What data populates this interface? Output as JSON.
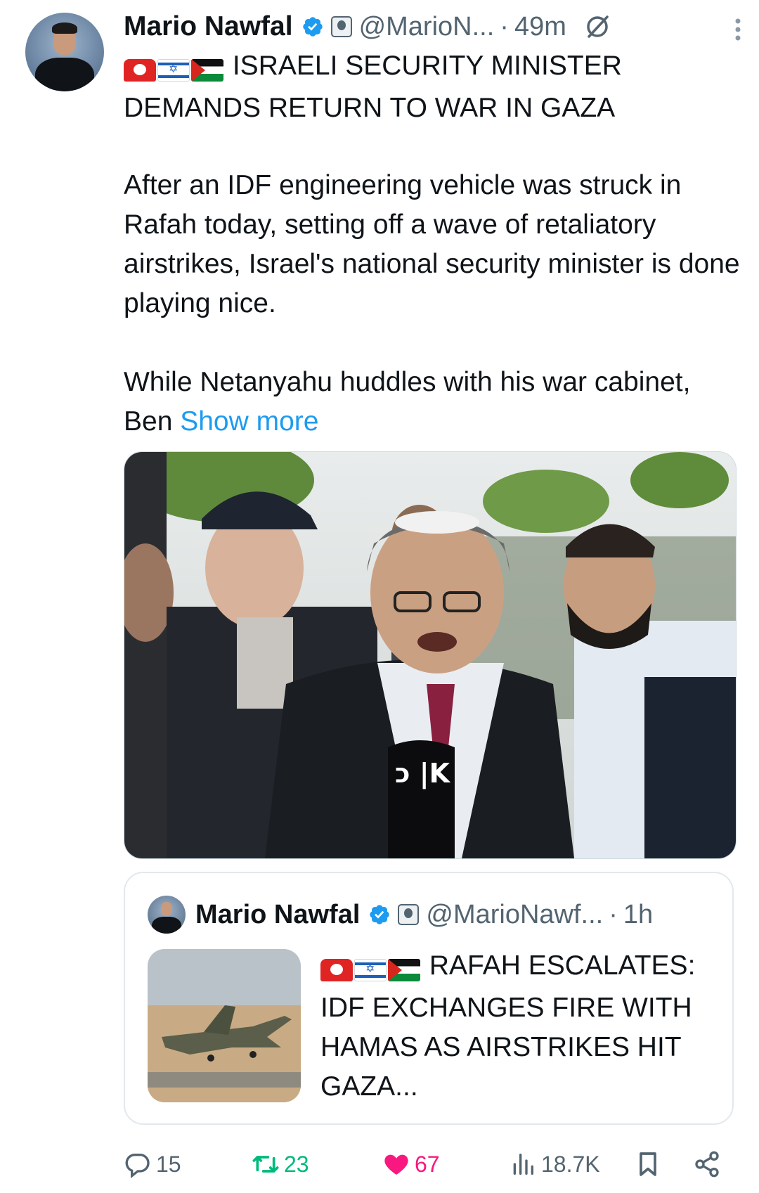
{
  "author": {
    "name": "Mario Nawfal",
    "handle": "@MarioN...",
    "separator": "·",
    "time": "49m"
  },
  "tweet": {
    "headline": "ISRAELI SECURITY MINISTER DEMANDS RETURN TO WAR IN GAZA",
    "paragraph1": "After an IDF engineering vehicle was struck in Rafah today, setting off a wave of retaliatory airstrikes, Israel's national security minister is done playing nice.",
    "paragraph2": "While Netanyahu huddles with his war cabinet, Ben ",
    "show_more": "Show more",
    "flag_icons": [
      "siren-icon",
      "israel-flag-icon",
      "palestine-flag-icon"
    ]
  },
  "photo": {
    "mic_text": "כ |K"
  },
  "quoted": {
    "name": "Mario Nawfal",
    "handle": "@MarioNawf...",
    "separator": "·",
    "time": "1h",
    "text": "RAFAH ESCALATES: IDF EXCHANGES FIRE WITH HAMAS AS AIRSTRIKES HIT GAZA..."
  },
  "actions": {
    "replies": "15",
    "reposts": "23",
    "likes": "67",
    "views": "18.7K"
  },
  "colors": {
    "link": "#1d9bf0",
    "verified": "#1d9bf0",
    "repost_active": "#00ba7c",
    "like_active": "#f91880",
    "muted": "#536471"
  }
}
